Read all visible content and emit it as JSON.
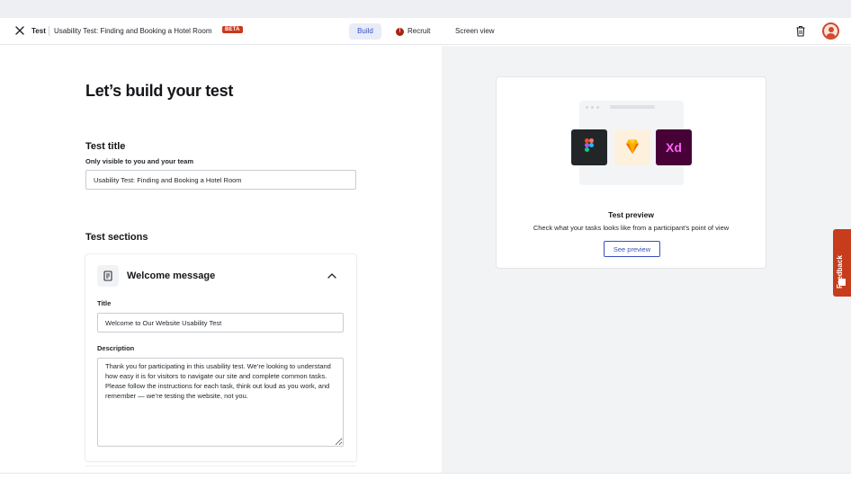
{
  "header": {
    "brand": "Test",
    "test_name": "Usability Test: Finding and Booking a Hotel Room",
    "badge": "BETA",
    "tabs": [
      {
        "label": "Build",
        "active": true
      },
      {
        "label": "Recruit",
        "status_icon": "alert-icon"
      },
      {
        "label": "Screen view"
      }
    ],
    "icons": [
      "close-icon",
      "trash-icon",
      "avatar"
    ]
  },
  "main": {
    "page_title": "Let’s build your test",
    "test_title": {
      "label": "Test title",
      "hint": "Only visible to you and your team",
      "value": "Usability Test: Finding and Booking a Hotel Room"
    },
    "sections_label": "Test sections",
    "welcome_section": {
      "title": "Welcome message",
      "title_field_label": "Title",
      "title_value": "Welcome to Our Website Usability Test",
      "description_label": "Description",
      "description_value": "Thank you for participating in this usability test. We’re looking to understand how easy it is for visitors to navigate our site and complete common tasks. Please follow the instructions for each task, think out loud as you work, and remember — we’re testing the website, not you."
    }
  },
  "preview": {
    "title": "Test preview",
    "subtitle": "Check what your tasks looks like from a participant's point of view",
    "button": "See preview",
    "app_icons": [
      "figma-icon",
      "sketch-icon",
      "xd-icon"
    ],
    "xd_label": "Xd"
  },
  "feedback_tab": {
    "label": "Feedback"
  },
  "colors": {
    "accent": "#3b4fbf",
    "badge": "#c8391e",
    "feedback": "#c63c1d",
    "panel_bg": "#f2f3f5"
  }
}
